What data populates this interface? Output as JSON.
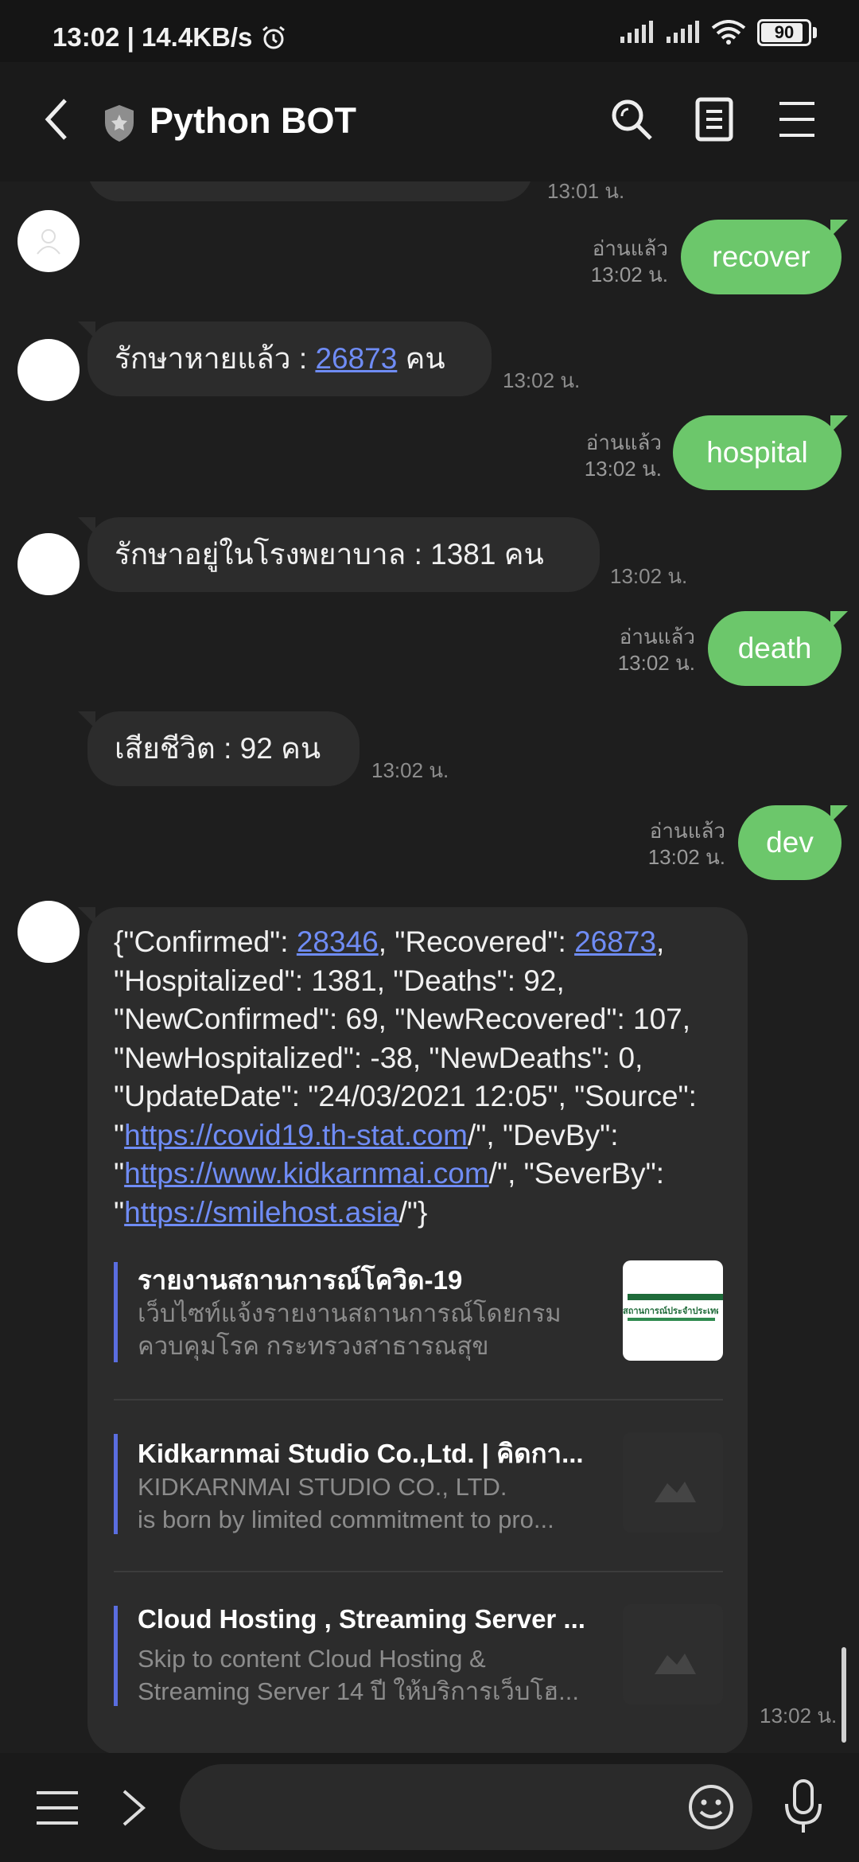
{
  "status_bar": {
    "time_speed": "13:02 | 14.4KB/s",
    "battery": "90"
  },
  "header": {
    "title": "Python BOT"
  },
  "messages": {
    "partial_time": "13:01 น.",
    "out": [
      {
        "text": "recover",
        "read": "อ่านแล้ว",
        "time": "13:02 น."
      },
      {
        "text": "hospital",
        "read": "อ่านแล้ว",
        "time": "13:02 น."
      },
      {
        "text": "death",
        "read": "อ่านแล้ว",
        "time": "13:02 น."
      },
      {
        "text": "dev",
        "read": "อ่านแล้ว",
        "time": "13:02 น."
      }
    ],
    "in": [
      {
        "prefix": "รักษาหายแล้ว : ",
        "link": "26873",
        "suffix": " คน",
        "time": "13:02 น."
      },
      {
        "text": "รักษาอยู่ในโรงพยาบาล : 1381 คน",
        "time": "13:02 น."
      },
      {
        "text": "เสียชีวิต : 92 คน",
        "time": "13:02 น."
      }
    ],
    "json_msg": {
      "p1": "{\"Confirmed\": ",
      "l1": "28346",
      "p2": ", \"Recovered\": ",
      "l2": "26873",
      "p3": ", \"Hospitalized\": 1381, \"Deaths\": 92, \"NewConfirmed\": 69, \"NewRecovered\": 107, \"NewHospitalized\": -38, \"NewDeaths\": 0, \"UpdateDate\": \"24/03/2021 12:05\", \"Source\": \"",
      "l3": "https://covid19.th-stat.com",
      "p4": "/\", \"DevBy\": \"",
      "l4": "https://www.kidkarnmai.com",
      "p5": "/\", \"SeverBy\": \"",
      "l5": "https://smilehost.asia",
      "p6": "/\"}",
      "time": "13:02 น."
    },
    "previews": [
      {
        "title": "รายงานสถานการณ์โควิด-19",
        "desc1": "เว็บไซท์แจ้งรายงานสถานการณ์โดยกรม",
        "desc2": "ควบคุมโรค กระทรวงสาธารณสุข",
        "thumb_text": "สถานการณ์ประจำประเทศ"
      },
      {
        "title": "Kidkarnmai Studio Co.,Ltd. | คิดกา...",
        "desc1": "KIDKARNMAI STUDIO CO., LTD.",
        "desc2": "is born by limited commitment to pro..."
      },
      {
        "title": "Cloud Hosting , Streaming Server ...",
        "desc1": "Skip to content Cloud Hosting &",
        "desc2": "Streaming Server 14 ปี ให้บริการเว็บโฮ..."
      }
    ]
  },
  "colors": {
    "bubble_out": "#6cc76b",
    "bubble_in": "#2c2c2c",
    "link": "#6f8cf5"
  }
}
